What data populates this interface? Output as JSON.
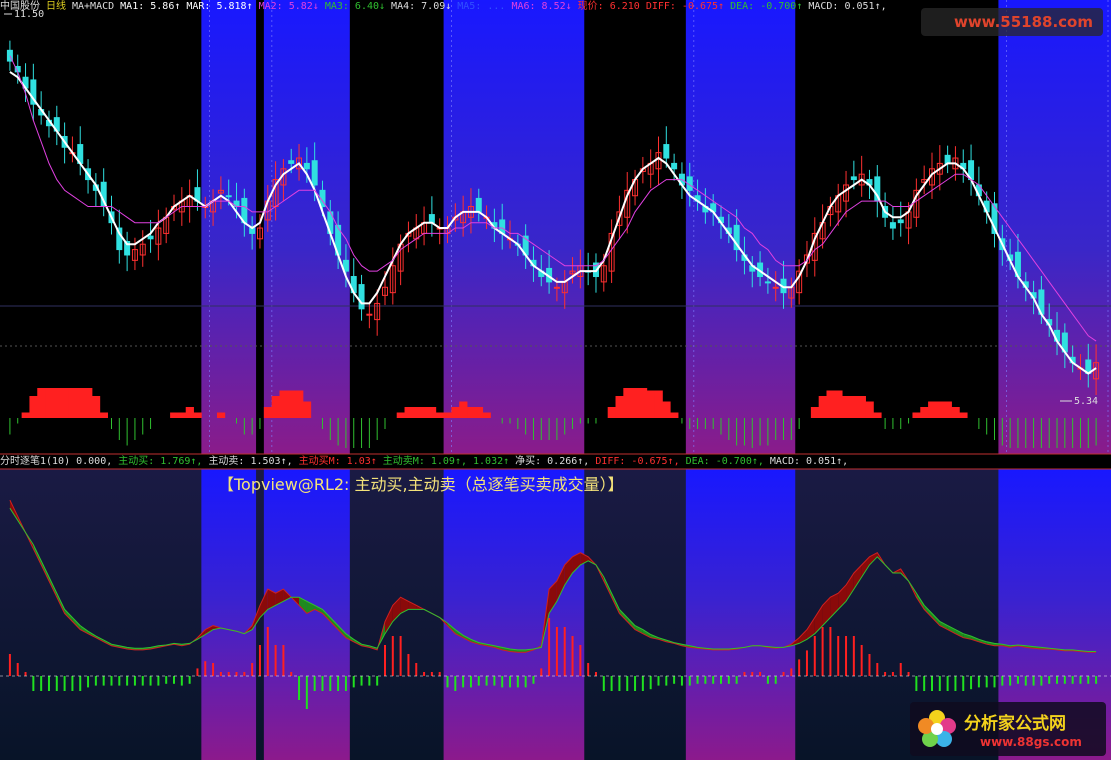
{
  "top_header": [
    {
      "text": "中国股份",
      "color": "#dddddd"
    },
    {
      "text": "日线",
      "color": "#e0d020"
    },
    {
      "text": "MA+MACD",
      "color": "#dddddd"
    },
    {
      "text": "MA1: 5.86↑",
      "color": "#ffffff"
    },
    {
      "text": "MAR: 5.818↑",
      "color": "#ffffff"
    },
    {
      "text": "MA2: 5.82↓",
      "color": "#e040e0"
    },
    {
      "text": "MA3: 6.40↓",
      "color": "#30c030"
    },
    {
      "text": "MA4: 7.09↓",
      "color": "#dddddd"
    },
    {
      "text": "MA5: ...",
      "color": "#3050ff"
    },
    {
      "text": "MA6: 8.52↓",
      "color": "#e040e0"
    },
    {
      "text": "现价: 6.210",
      "color": "#ff3030"
    },
    {
      "text": "DIFF: -0.675↑",
      "color": "#ff3030"
    },
    {
      "text": "DEA: -0.700↑",
      "color": "#30c030"
    },
    {
      "text": "MACD: 0.051↑,",
      "color": "#dddddd"
    }
  ],
  "bottom_header": [
    {
      "text": "分时逐笔1(10) 0.000,",
      "color": "#dddddd"
    },
    {
      "text": "主动买: 1.769↑,",
      "color": "#30c030"
    },
    {
      "text": "主动卖: 1.503↑,",
      "color": "#dddddd"
    },
    {
      "text": "主动买M: 1.03↑",
      "color": "#ff3030"
    },
    {
      "text": "主动卖M: 1.09↑, 1.032↑",
      "color": "#30c030"
    },
    {
      "text": "净买: 0.266↑,",
      "color": "#dddddd"
    },
    {
      "text": "DIFF: -0.675↑,",
      "color": "#ff3030"
    },
    {
      "text": "DEA: -0.700↑,",
      "color": "#30c030"
    },
    {
      "text": "MACD: 0.051↑,",
      "color": "#dddddd"
    }
  ],
  "overlay_title": "【Topview@RL2: 主动买,主动卖（总逐笔买卖成交量）】",
  "price_high_label": "11.50",
  "price_low_label": "5.34",
  "watermark_top": "www.55188.com",
  "watermark_bottom_title": "分析家公式网",
  "watermark_bottom_url": "www.88gs.com",
  "colors": {
    "up": "#ff3030",
    "down": "#30e0e0",
    "ma1": "#ffffff",
    "ma2": "#e040e0",
    "ma3": "#30c030",
    "ma4": "#dddddd",
    "ma5": "#3050ff",
    "ma6": "#e040e0",
    "buy": "#ff2020",
    "sell": "#20e020",
    "band_blue": "#1818ff"
  },
  "chart_data": [
    {
      "type": "candlestick",
      "title": "中国股份 日线 MA+MACD",
      "ylim": [
        5.0,
        12.0
      ],
      "annotations": [
        "11.50",
        "5.34"
      ],
      "shaded_bands_bar_index": [
        [
          25,
          32
        ],
        [
          33,
          44
        ],
        [
          56,
          74
        ],
        [
          87,
          101
        ],
        [
          127,
          140
        ],
        [
          140,
          157
        ]
      ],
      "close": [
        11.2,
        11.0,
        10.7,
        10.4,
        10.2,
        10.0,
        9.9,
        9.6,
        9.5,
        9.3,
        9.0,
        8.8,
        8.5,
        8.2,
        7.7,
        7.6,
        7.7,
        7.8,
        7.9,
        8.1,
        8.3,
        8.5,
        8.6,
        8.7,
        8.6,
        8.5,
        8.6,
        8.8,
        8.7,
        8.5,
        8.2,
        8.0,
        8.1,
        8.6,
        9.0,
        9.2,
        9.3,
        9.4,
        9.2,
        8.9,
        8.5,
        8.0,
        7.6,
        7.3,
        6.9,
        6.6,
        6.5,
        6.7,
        7.0,
        7.4,
        7.8,
        8.0,
        8.1,
        8.2,
        8.2,
        8.1,
        8.1,
        8.3,
        8.4,
        8.5,
        8.4,
        8.3,
        8.1,
        8.0,
        7.9,
        7.8,
        7.6,
        7.4,
        7.2,
        7.1,
        7.0,
        7.1,
        7.3,
        7.4,
        7.3,
        7.2,
        7.4,
        8.0,
        8.4,
        8.8,
        9.0,
        9.2,
        9.3,
        9.5,
        9.4,
        9.2,
        8.9,
        8.8,
        8.6,
        8.4,
        8.4,
        8.2,
        8.0,
        7.7,
        7.5,
        7.3,
        7.2,
        7.1,
        7.0,
        6.9,
        7.0,
        7.3,
        7.6,
        8.0,
        8.2,
        8.5,
        8.7,
        8.9,
        9.0,
        9.1,
        8.9,
        8.6,
        8.3,
        8.1,
        8.2,
        8.4,
        8.8,
        9.0,
        9.2,
        9.3,
        9.3,
        9.4,
        9.2,
        9.0,
        8.7,
        8.4,
        8.0,
        7.7,
        7.5,
        7.2,
        7.0,
        6.8,
        6.5,
        6.3,
        6.0,
        5.8,
        5.6,
        5.5,
        5.4,
        5.6
      ],
      "ma_series": [
        {
          "name": "MA1",
          "values": [
            11.0,
            10.9,
            10.7,
            10.5,
            10.3,
            10.1,
            9.9,
            9.7,
            9.5,
            9.3,
            9.1,
            8.9,
            8.6,
            8.3,
            8.0,
            7.8,
            7.8,
            7.9,
            8.0,
            8.2,
            8.3,
            8.5,
            8.6,
            8.7,
            8.6,
            8.5,
            8.6,
            8.7,
            8.6,
            8.4,
            8.2,
            8.1,
            8.2,
            8.6,
            8.9,
            9.1,
            9.2,
            9.3,
            9.1,
            8.8,
            8.4,
            8.0,
            7.6,
            7.2,
            6.9,
            6.7,
            6.7,
            6.9,
            7.2,
            7.5,
            7.8,
            8.0,
            8.1,
            8.2,
            8.2,
            8.1,
            8.1,
            8.3,
            8.4,
            8.4,
            8.4,
            8.3,
            8.1,
            8.0,
            7.9,
            7.8,
            7.6,
            7.4,
            7.3,
            7.2,
            7.1,
            7.1,
            7.2,
            7.3,
            7.3,
            7.3,
            7.5,
            7.9,
            8.3,
            8.7,
            9.0,
            9.2,
            9.3,
            9.4,
            9.3,
            9.1,
            8.9,
            8.7,
            8.6,
            8.5,
            8.4,
            8.2,
            8.0,
            7.8,
            7.6,
            7.4,
            7.3,
            7.2,
            7.1,
            7.0,
            7.0,
            7.2,
            7.5,
            7.9,
            8.2,
            8.5,
            8.7,
            8.8,
            8.9,
            9.0,
            8.9,
            8.7,
            8.4,
            8.3,
            8.3,
            8.4,
            8.7,
            8.9,
            9.1,
            9.2,
            9.3,
            9.3,
            9.2,
            9.0,
            8.7,
            8.4,
            8.1,
            7.8,
            7.5,
            7.2,
            7.0,
            6.8,
            6.5,
            6.3,
            6.0,
            5.8,
            5.6,
            5.5,
            5.4,
            5.5
          ]
        },
        {
          "name": "MA2",
          "values": [
            11.3,
            11.0,
            10.6,
            10.1,
            9.7,
            9.3,
            9.0,
            8.8,
            8.7,
            8.6,
            8.5,
            8.5,
            8.5,
            8.5,
            8.4,
            8.3,
            8.2,
            8.2,
            8.2,
            8.2,
            8.3,
            8.4,
            8.5,
            8.5,
            8.5,
            8.5,
            8.6,
            8.6,
            8.6,
            8.5,
            8.5,
            8.4,
            8.4,
            8.4,
            8.5,
            8.6,
            8.7,
            8.8,
            8.8,
            8.8,
            8.6,
            8.4,
            8.1,
            7.9,
            7.6,
            7.4,
            7.3,
            7.3,
            7.4,
            7.5,
            7.7,
            7.8,
            7.9,
            8.0,
            8.0,
            8.0,
            8.0,
            8.1,
            8.1,
            8.2,
            8.2,
            8.2,
            8.1,
            8.1,
            8.0,
            8.0,
            7.9,
            7.8,
            7.7,
            7.6,
            7.5,
            7.4,
            7.4,
            7.4,
            7.4,
            7.4,
            7.5,
            7.7,
            7.9,
            8.1,
            8.4,
            8.6,
            8.8,
            8.9,
            9.0,
            9.0,
            9.0,
            8.9,
            8.8,
            8.7,
            8.6,
            8.5,
            8.4,
            8.3,
            8.1,
            8.0,
            7.8,
            7.7,
            7.5,
            7.4,
            7.4,
            7.4,
            7.5,
            7.7,
            7.8,
            8.0,
            8.2,
            8.4,
            8.5,
            8.6,
            8.6,
            8.6,
            8.6,
            8.5,
            8.5,
            8.5,
            8.6,
            8.7,
            8.8,
            8.9,
            9.0,
            9.1,
            9.1,
            9.0,
            8.9,
            8.7,
            8.5,
            8.3,
            8.1,
            7.9,
            7.7,
            7.5,
            7.3,
            7.1,
            6.9,
            6.7,
            6.5,
            6.3,
            6.1,
            6.0
          ]
        }
      ],
      "macd_hist_range": [
        -0.6,
        0.6
      ]
    },
    {
      "type": "area",
      "title": "分时逐笔1(10)",
      "series": [
        {
          "name": "主动买",
          "values": [
            2.4,
            2.2,
            2.0,
            1.8,
            1.6,
            1.4,
            1.2,
            1.0,
            0.9,
            0.8,
            0.75,
            0.7,
            0.65,
            0.6,
            0.58,
            0.56,
            0.55,
            0.55,
            0.56,
            0.58,
            0.6,
            0.62,
            0.6,
            0.62,
            0.7,
            0.8,
            0.85,
            0.82,
            0.8,
            0.78,
            0.75,
            0.85,
            1.1,
            1.3,
            1.25,
            1.3,
            1.2,
            1.1,
            1.0,
            1.05,
            1.0,
            0.9,
            0.8,
            0.7,
            0.65,
            0.6,
            0.58,
            0.55,
            0.9,
            1.1,
            1.2,
            1.15,
            1.1,
            1.05,
            1.0,
            0.95,
            0.85,
            0.75,
            0.7,
            0.65,
            0.62,
            0.6,
            0.58,
            0.55,
            0.53,
            0.52,
            0.52,
            0.55,
            0.6,
            1.3,
            1.4,
            1.6,
            1.7,
            1.75,
            1.7,
            1.6,
            1.4,
            1.2,
            1.0,
            0.9,
            0.8,
            0.75,
            0.7,
            0.68,
            0.65,
            0.63,
            0.6,
            0.58,
            0.57,
            0.56,
            0.55,
            0.55,
            0.55,
            0.56,
            0.58,
            0.6,
            0.6,
            0.58,
            0.57,
            0.58,
            0.62,
            0.7,
            0.8,
            0.95,
            1.1,
            1.2,
            1.25,
            1.35,
            1.5,
            1.6,
            1.7,
            1.75,
            1.6,
            1.5,
            1.55,
            1.4,
            1.2,
            1.05,
            0.95,
            0.85,
            0.8,
            0.75,
            0.7,
            0.68,
            0.65,
            0.62,
            0.6,
            0.6,
            0.58,
            0.6,
            0.58,
            0.57,
            0.56,
            0.56,
            0.55,
            0.54,
            0.54,
            0.53,
            0.52,
            0.52
          ]
        },
        {
          "name": "主动卖",
          "values": [
            2.3,
            2.15,
            2.0,
            1.85,
            1.65,
            1.45,
            1.25,
            1.05,
            0.95,
            0.85,
            0.78,
            0.72,
            0.67,
            0.62,
            0.6,
            0.58,
            0.57,
            0.57,
            0.58,
            0.6,
            0.61,
            0.63,
            0.62,
            0.63,
            0.68,
            0.74,
            0.8,
            0.82,
            0.8,
            0.78,
            0.75,
            0.8,
            0.95,
            1.05,
            1.1,
            1.15,
            1.2,
            1.2,
            1.15,
            1.1,
            1.05,
            0.95,
            0.85,
            0.75,
            0.68,
            0.62,
            0.6,
            0.57,
            0.75,
            0.9,
            1.0,
            1.05,
            1.05,
            1.05,
            1.0,
            0.95,
            0.88,
            0.8,
            0.73,
            0.68,
            0.64,
            0.62,
            0.6,
            0.58,
            0.56,
            0.55,
            0.55,
            0.56,
            0.58,
            1.0,
            1.15,
            1.35,
            1.5,
            1.6,
            1.65,
            1.6,
            1.45,
            1.25,
            1.05,
            0.95,
            0.85,
            0.8,
            0.74,
            0.7,
            0.67,
            0.64,
            0.62,
            0.6,
            0.58,
            0.57,
            0.56,
            0.56,
            0.56,
            0.57,
            0.58,
            0.6,
            0.6,
            0.59,
            0.58,
            0.58,
            0.6,
            0.63,
            0.68,
            0.75,
            0.85,
            0.95,
            1.05,
            1.15,
            1.3,
            1.45,
            1.6,
            1.7,
            1.6,
            1.5,
            1.5,
            1.4,
            1.25,
            1.1,
            1.0,
            0.9,
            0.85,
            0.8,
            0.75,
            0.72,
            0.68,
            0.65,
            0.63,
            0.62,
            0.6,
            0.61,
            0.6,
            0.59,
            0.58,
            0.57,
            0.56,
            0.55,
            0.55,
            0.54,
            0.53,
            0.53
          ]
        }
      ]
    }
  ]
}
